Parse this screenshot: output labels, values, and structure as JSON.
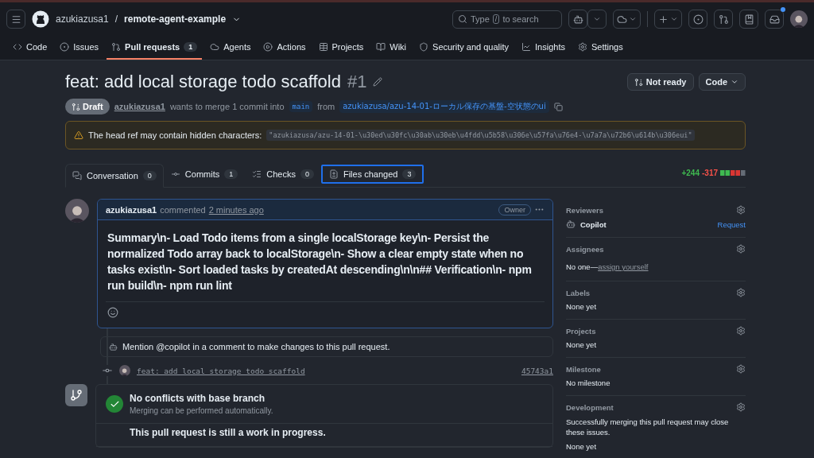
{
  "header": {
    "owner": "azukiazusa1",
    "separator": "/",
    "repo": "remote-agent-example",
    "search_prefix": "Type",
    "search_key": "/",
    "search_suffix": "to search",
    "notification_dot": true
  },
  "nav": [
    {
      "label": "Code",
      "selected": false
    },
    {
      "label": "Issues",
      "selected": false
    },
    {
      "label": "Pull requests",
      "count": "1",
      "selected": true
    },
    {
      "label": "Agents",
      "selected": false
    },
    {
      "label": "Actions",
      "selected": false
    },
    {
      "label": "Projects",
      "selected": false
    },
    {
      "label": "Wiki",
      "selected": false
    },
    {
      "label": "Security and quality",
      "selected": false
    },
    {
      "label": "Insights",
      "selected": false
    },
    {
      "label": "Settings",
      "selected": false
    }
  ],
  "pr": {
    "title": "feat: add local storage todo scaffold",
    "number": "#1",
    "state": "Draft",
    "author": "azukiazusa1",
    "merge_text": "wants to merge 1 commit into",
    "base": "main",
    "from": "from",
    "head": "azukiazusa/azu-14-01-ローカル保存の基盤-空状態のui",
    "ready_button": "Not ready",
    "code_button": "Code"
  },
  "warning": {
    "label": "The head ref may contain hidden characters:",
    "value": "\"azukiazusa/azu-14-01-\\u30ed\\u30fc\\u30ab\\u30eb\\u4fdd\\u5b58\\u306e\\u57fa\\u76e4-\\u7a7a\\u72b6\\u614b\\u306eui\""
  },
  "tabs": [
    {
      "label": "Conversation",
      "count": "0",
      "selected": true,
      "focused": false
    },
    {
      "label": "Commits",
      "count": "1",
      "selected": false,
      "focused": false
    },
    {
      "label": "Checks",
      "count": "0",
      "selected": false,
      "focused": false
    },
    {
      "label": "Files changed",
      "count": "3",
      "selected": false,
      "focused": true
    }
  ],
  "diff": {
    "additions": "+244",
    "deletions": "-317"
  },
  "comment": {
    "author": "azukiazusa1",
    "action": "commented",
    "time": "2 minutes ago",
    "badge": "Owner",
    "body": "Summary\\n- Load Todo items from a single localStorage key\\n- Persist the normalized Todo array back to localStorage\\n- Show a clear empty state when no tasks exist\\n- Sort loaded tasks by createdAt descending\\n\\n## Verification\\n- npm run build\\n- npm run lint"
  },
  "mention": "Mention @copilot in a comment to make changes to this pull request.",
  "commit": {
    "message": "feat: add local storage todo scaffold",
    "sha": "45743a1"
  },
  "merge": {
    "title": "No conflicts with base branch",
    "subtitle": "Merging can be performed automatically.",
    "next": "This pull request is still a work in progress."
  },
  "sidebar": [
    {
      "title": "Reviewers",
      "kind": "reviewer",
      "name": "Copilot",
      "action": "Request"
    },
    {
      "title": "Assignees",
      "kind": "assign",
      "value": "No one—",
      "link": "assign yourself"
    },
    {
      "title": "Labels",
      "kind": "text",
      "value": "None yet"
    },
    {
      "title": "Projects",
      "kind": "text",
      "value": "None yet"
    },
    {
      "title": "Milestone",
      "kind": "text",
      "value": "No milestone"
    },
    {
      "title": "Development",
      "kind": "dev",
      "value": "Successfully merging this pull request may close these issues.",
      "extra": "None yet"
    }
  ]
}
